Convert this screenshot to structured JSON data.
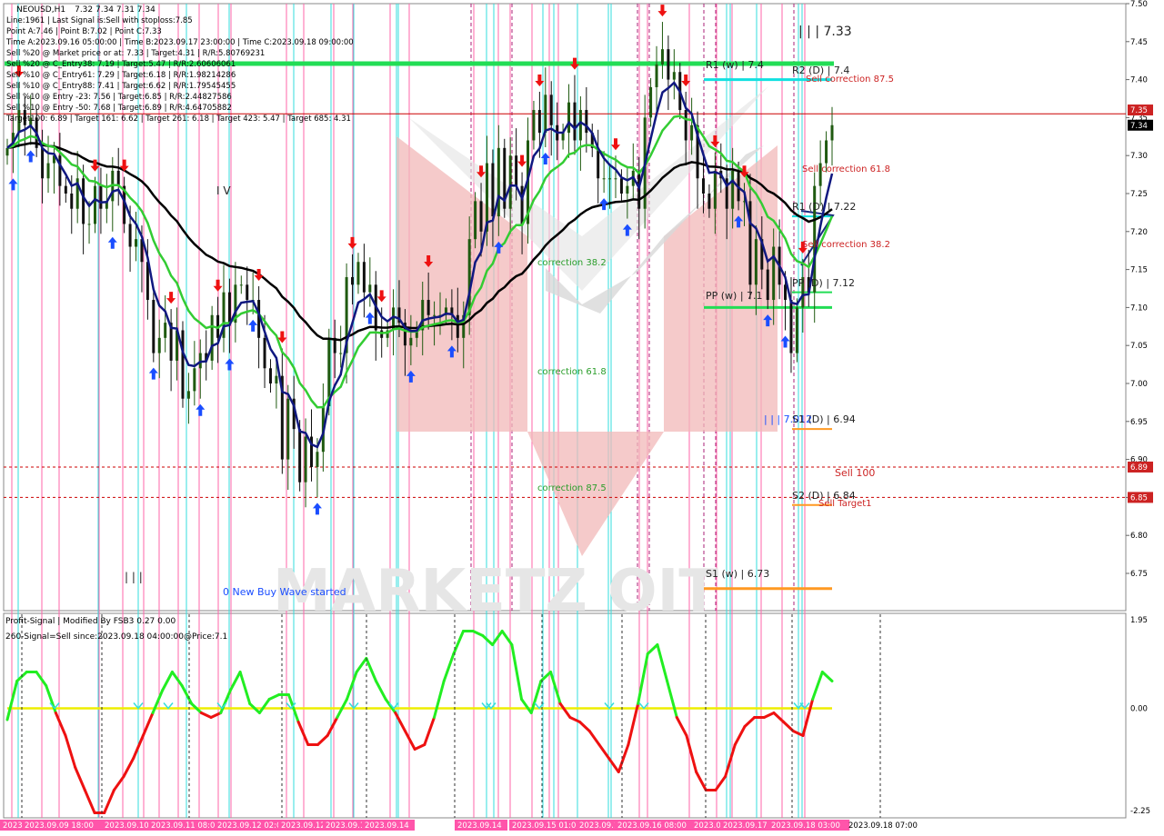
{
  "header": {
    "symbol": "NEOUSD,H1",
    "ohlc": "7.32 7.34 7.31 7.34",
    "lines": [
      "Line:1961 | Last Signal is:Sell with stoploss:7.85",
      "Point A:7.46 | Point B:7.02 | Point C:7.33",
      "Time A:2023.09.16 05:00:00 | Time B:2023.09.17 23:00:00 | Time C:2023.09.18 09:00:00",
      "Sell %20 @ Market price or at: 7.33 | Target:4.31 | R/R:5.80769231",
      "Sell %20 @ C_Entry38: 7.19 | Target:5.47 | R/R:2.60606061",
      "Sell %10 @ C_Entry61: 7.29 | Target:6.18 | R/R:1.98214286",
      "Sell %10 @ C_Entry88: 7.41 | Target:6.62 | R/R:1.79545455",
      "Sell %10 @ Entry -23: 7.56 | Target:6.85 | R/R:2.44827586",
      "Sell %10 @ Entry -50: 7.68 | Target:6.89 | R/R:4.64705882",
      "Target100: 6.89 | Target 161: 6.62 | Target 261: 6.18 | Target 423: 5.47 | Target 685: 4.31"
    ]
  },
  "indicator_header": {
    "line1": "Profit-Signal | Modified By FSB3 0.27 0.00",
    "line2": "260-Signal=Sell since:2023.09.18 04:00:00@Price:7.1"
  },
  "colors": {
    "background": "#ffffff",
    "bull_candle": "#1f5a10",
    "bear_candle": "#111111",
    "ma_fast": "#101880",
    "ma_mid": "#33cc33",
    "ma_slow": "#000000",
    "price_line": "#cc0000",
    "buy_arrow": "#1a4dff",
    "sell_arrow": "#ee1111",
    "osc_up": "#22ee22",
    "osc_down": "#ee1111",
    "zero_line": "#eeee00",
    "pivot_green": "#22dd55",
    "cyan_line": "#11e0e0",
    "orange_line": "#ff9922",
    "vline_pink": "#ff66aa",
    "vline_cyan": "#33dddd",
    "vline_magenta": "#aa2277"
  },
  "annotations": {
    "r1_weekly": "R1 (w) | 7.4",
    "r2_daily": "R2 (D) | 7.4",
    "sell_correction_875": "Sell correction 87.5",
    "sell_correction_618": "Sell correction 61.8",
    "sell_correction_382": "Sell correction 38.2",
    "r1_daily": "R1 (D) | 7.22",
    "pp_daily": "PP (D) | 7.12",
    "pp_weekly": "PP (w) | 7.1",
    "s1_daily": "S1 (D) | 6.94",
    "sell_100": "Sell 100",
    "s2_daily": "S2 (D) | 6.84",
    "sell_target1": "Sell Target1",
    "s1_weekly": "S1 (w) | 6.73",
    "correction_382": "correction 38.2",
    "correction_618": "correction 61.8",
    "correction_875": "correction 87.5",
    "new_buy_wave": "0 New Buy Wave started",
    "marker_733": "| | | 7.33",
    "marker_s1": "| | | 7.012",
    "marker_iv": "I V",
    "marker_iii": "| | |"
  },
  "chart_data": [
    {
      "type": "candlestick",
      "title": "NEOUSD,H1",
      "ylim": [
        6.7,
        7.5
      ],
      "y_ticks": [
        7.5,
        7.45,
        7.4,
        7.35,
        7.3,
        7.25,
        7.2,
        7.15,
        7.1,
        7.05,
        7.0,
        6.95,
        6.9,
        6.85,
        6.8,
        6.75
      ],
      "price_tags": [
        {
          "value": 7.36,
          "label": "7.35",
          "color": "#cc2222"
        },
        {
          "value": 7.34,
          "label": "7.34",
          "color": "#000000"
        },
        {
          "value": 6.89,
          "label": "6.89",
          "color": "#cc2222"
        },
        {
          "value": 6.85,
          "label": "6.85",
          "color": "#cc2222"
        }
      ],
      "horizontal_levels": [
        {
          "name": "price_line",
          "value": 7.355
        },
        {
          "name": "sell_100",
          "value": 6.89
        },
        {
          "name": "sell_target1",
          "value": 6.85
        }
      ],
      "close": [
        7.31,
        7.33,
        7.36,
        7.34,
        7.35,
        7.31,
        7.27,
        7.29,
        7.3,
        7.26,
        7.25,
        7.23,
        7.27,
        7.21,
        7.21,
        7.26,
        7.23,
        7.24,
        7.28,
        7.26,
        7.21,
        7.18,
        7.19,
        7.16,
        7.11,
        7.04,
        7.06,
        7.08,
        7.03,
        7.07,
        6.98,
        6.99,
        7.02,
        7.04,
        7.03,
        7.09,
        7.06,
        7.12,
        7.08,
        7.13,
        7.13,
        7.11,
        7.11,
        7.06,
        7.02,
        7.0,
        7.01,
        6.9,
        6.98,
        6.94,
        6.87,
        6.93,
        6.89,
        6.91,
        6.97,
        7.06,
        7.04,
        7.04,
        7.14,
        7.13,
        7.16,
        7.12,
        7.13,
        7.07,
        7.06,
        7.07,
        7.1,
        7.08,
        7.05,
        7.06,
        7.07,
        7.11,
        7.09,
        7.09,
        7.09,
        7.1,
        7.09,
        7.06,
        7.09,
        7.19,
        7.24,
        7.2,
        7.29,
        7.22,
        7.31,
        7.23,
        7.3,
        7.26,
        7.21,
        7.32,
        7.36,
        7.33,
        7.38,
        7.34,
        7.32,
        7.33,
        7.37,
        7.32,
        7.36,
        7.33,
        7.31,
        7.27,
        7.27,
        7.27,
        7.27,
        7.25,
        7.26,
        7.28,
        7.23,
        7.35,
        7.39,
        7.42,
        7.44,
        7.4,
        7.41,
        7.36,
        7.32,
        7.34,
        7.27,
        7.25,
        7.23,
        7.28,
        7.27,
        7.23,
        7.28,
        7.24,
        7.24,
        7.13,
        7.19,
        7.15,
        7.11,
        7.18,
        7.13,
        7.11,
        7.04,
        7.1,
        7.14,
        7.12,
        7.26,
        7.29,
        7.32,
        7.34
      ]
    },
    {
      "type": "line",
      "title": "Profit-Signal",
      "ylim": [
        -2.25,
        1.95
      ],
      "y_ticks": [
        1.95,
        0.0,
        -2.25
      ],
      "x_ticks": [
        "2023.09.08",
        "2023.09.09 18:00",
        "2023.09.10",
        "2023.09.11 08:00",
        "2023.09.12 02:00",
        "2023.09.12",
        "2023.09.13 07:00",
        "2023.09.14",
        "2023.09.14",
        "2023.09.15 01:00",
        "2023.09.15",
        "2023.09.16 08:00",
        "2023.09.17",
        "2023.09.17",
        "2023.09.18 03:00",
        "2023.09.18 07:00"
      ],
      "values": [
        -0.25,
        0.6,
        0.8,
        0.8,
        0.5,
        -0.1,
        -0.6,
        -1.3,
        -1.8,
        -2.3,
        -2.3,
        -1.8,
        -1.5,
        -1.1,
        -0.6,
        -0.1,
        0.4,
        0.8,
        0.5,
        0.1,
        -0.1,
        -0.2,
        -0.1,
        0.4,
        0.8,
        0.1,
        -0.1,
        0.2,
        0.3,
        0.3,
        -0.3,
        -0.8,
        -0.8,
        -0.6,
        -0.2,
        0.2,
        0.8,
        1.1,
        0.6,
        0.2,
        -0.1,
        -0.5,
        -0.9,
        -0.8,
        -0.2,
        0.6,
        1.2,
        1.7,
        1.7,
        1.6,
        1.4,
        1.7,
        1.4,
        0.2,
        -0.1,
        0.6,
        0.8,
        0.1,
        -0.2,
        -0.3,
        -0.5,
        -0.8,
        -1.1,
        -1.4,
        -0.8,
        0.1,
        1.2,
        1.4,
        0.6,
        -0.2,
        -0.6,
        -1.4,
        -1.8,
        -1.8,
        -1.5,
        -0.8,
        -0.4,
        -0.2,
        -0.2,
        -0.1,
        -0.3,
        -0.5,
        -0.6,
        0.2,
        0.8,
        0.6
      ]
    }
  ]
}
